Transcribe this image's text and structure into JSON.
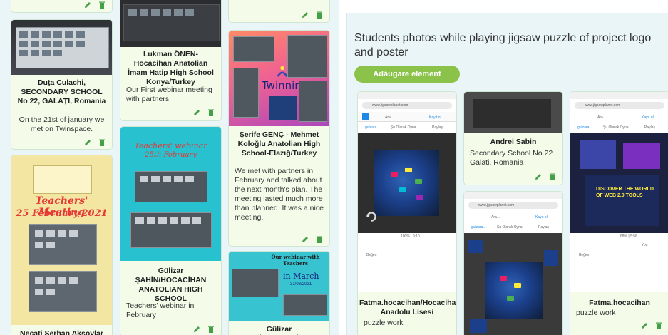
{
  "left_cards": [
    {
      "title": "Duța Culachi, SECONDARY SCHOOL No 22, GALAȚI, Romania",
      "text": "On the 21st of january we met on Twinspace."
    },
    {
      "title": "Lukman ÖNEN-Hocacihan Anatolian İmam Hatip High School Konya/Turkey",
      "text": "Our First webinar meeting with partners"
    },
    {
      "title": "Şerife GENÇ - Mehmet Koloğlu Anatolian High School-Elazığ/Turkey",
      "text": "We met with partners in February and talked about the next month's plan. The meeting lasted  much more than planned. It was a nice meeting.",
      "image_text": "Twinnir"
    },
    {
      "title": "Gülizar ŞAHİN/HOCACİHAN ANATOLIAN HIGH SCHOOL",
      "text": "Teachers' webinar in February",
      "image_title": "Teachers' webinar",
      "image_date": "25th February"
    },
    {
      "title": "Necati Serhan Aksoylar",
      "image_title_1": "Teachers' Meeting",
      "image_title_2": "25 February 2021"
    },
    {
      "title": "Gülizar ŞAHİN/HOCACİHAN",
      "image_title": "Our webinar with Teachers",
      "image_month": "in March",
      "image_date": "31/03/2021"
    }
  ],
  "section": {
    "title": "Students photos while playing jigsaw puzzle of project logo and poster",
    "add_button": "Adăugare element"
  },
  "right_cards": [
    {
      "title": "Fatma.hocacihan/Hocacihan Anadolu Lisesi",
      "text": "puzzle work"
    },
    {
      "title": "Andrei Sabin",
      "text": "Secondary School No.22 Galati, Romania"
    },
    {
      "title": "Fatma.hocacihan",
      "text": "puzzle work"
    }
  ],
  "phone_ui": {
    "url": "www.jigsawplanet.com",
    "search_placeholder": "Ara...",
    "login_text": "Kayıt ol",
    "user_text": "gulzara...",
    "play_text": "Şu Olarak Oyna",
    "share_text": "Paylaş",
    "progress_text": "100% | 9:10",
    "progress_text_2": "68% | 5:56",
    "poster_text": "DISCOVER THE WORLD OF WEB 2.0 TOOLS",
    "like_text": "Beğen",
    "you_text": "You"
  },
  "colors": {
    "panel_bg": "#eaf5f7",
    "card_bg": "#f4fbe9",
    "accent_green": "#8bc34a",
    "action_green": "#43a047"
  },
  "icons": {
    "edit": "pencil-icon",
    "delete": "trash-icon"
  }
}
